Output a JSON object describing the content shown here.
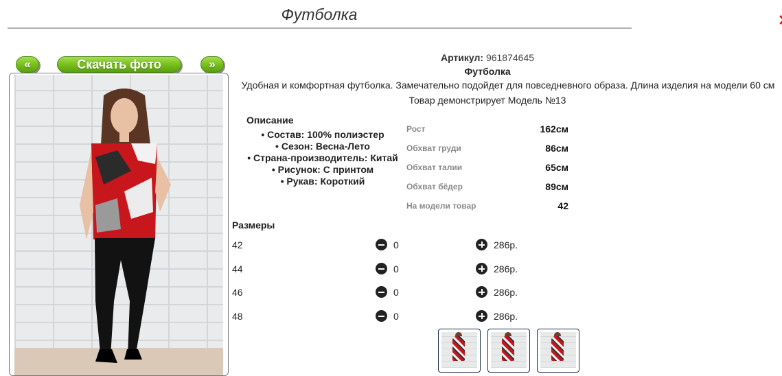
{
  "header": {
    "title": "Футболка"
  },
  "gallery": {
    "prev_label": "«",
    "download_label": "Скачать фото",
    "next_label": "»"
  },
  "product": {
    "sku_label": "Артикул:",
    "sku_value": "961874645",
    "name": "Футболка",
    "description": "Удобная и комфортная футболка. Замечательно подойдет для повседневного образа. Длина изделия на модели 60 см",
    "model_note": "Товар демонстрирует Модель №13"
  },
  "description_block": {
    "heading": "Описание",
    "items": [
      "Состав: 100% полиэстер",
      "Сезон: Весна-Лето",
      "Страна-производитель: Китай",
      "Рисунок: С принтом",
      "Рукав: Короткий"
    ]
  },
  "measurements": [
    {
      "label": "Рост",
      "value": "162см"
    },
    {
      "label": "Обхват груди",
      "value": "86см"
    },
    {
      "label": "Обхват талии",
      "value": "65см"
    },
    {
      "label": "Обхват бёдер",
      "value": "89см"
    },
    {
      "label": "На модели товар",
      "value": "42"
    }
  ],
  "sizes": {
    "heading": "Размеры",
    "rows": [
      {
        "size": "42",
        "qty": "0",
        "price": "286р."
      },
      {
        "size": "44",
        "qty": "0",
        "price": "286р."
      },
      {
        "size": "46",
        "qty": "0",
        "price": "286р."
      },
      {
        "size": "48",
        "qty": "0",
        "price": "286р."
      }
    ]
  },
  "icons": {
    "minus": "minus-circle-icon",
    "plus": "plus-circle-icon"
  },
  "colors": {
    "button_green": "#7cc21f",
    "thumb_border": "#1b2c46"
  }
}
